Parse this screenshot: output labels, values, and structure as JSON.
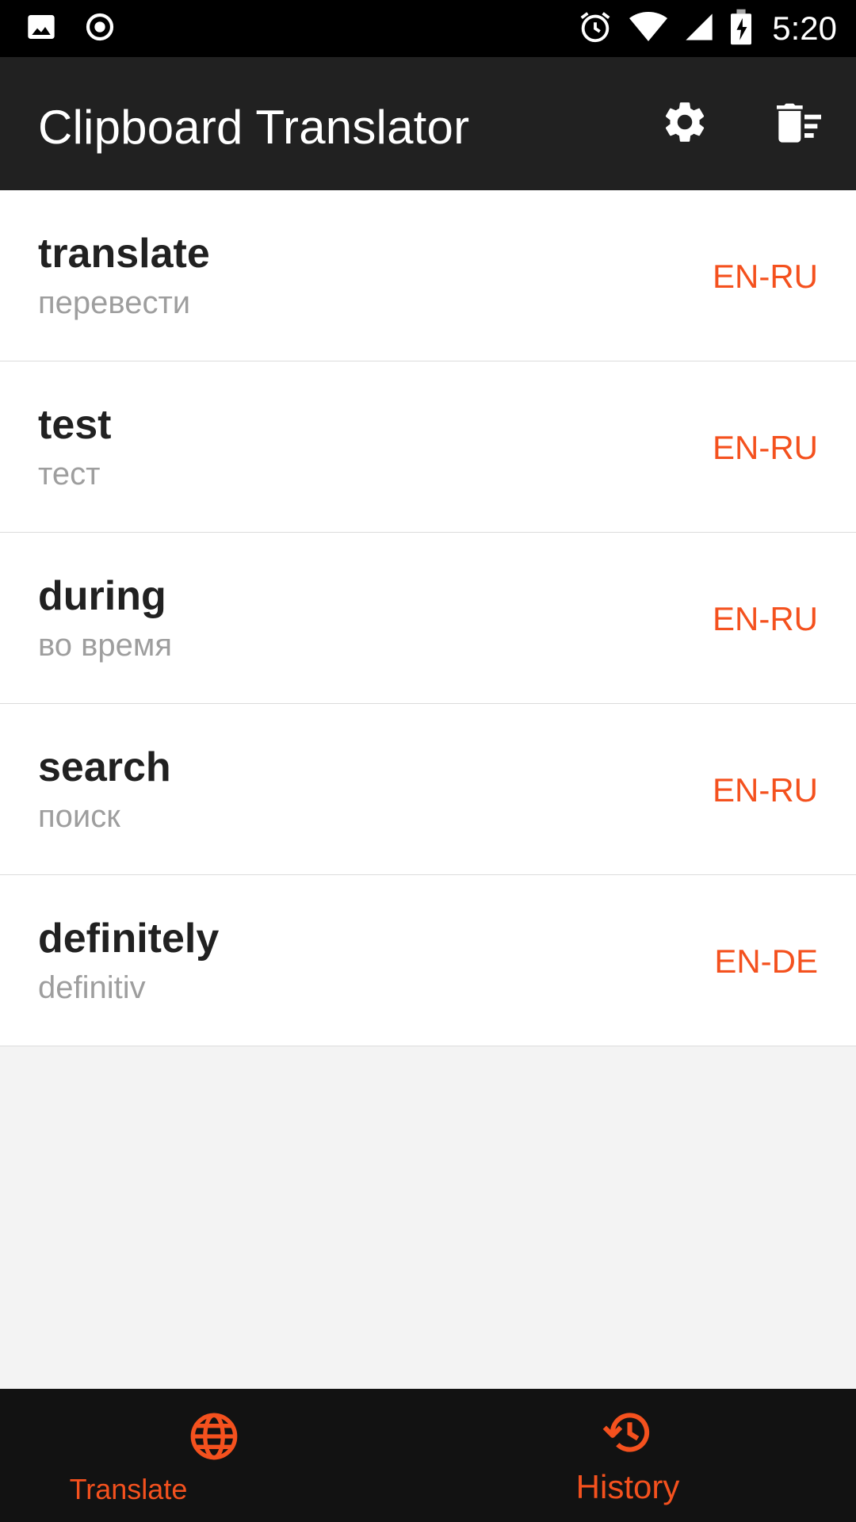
{
  "status_bar": {
    "time": "5:20",
    "icons": [
      "image-icon",
      "record-icon",
      "alarm-icon",
      "wifi-icon",
      "signal-icon",
      "battery-charging-icon"
    ]
  },
  "app_bar": {
    "title": "Clipboard Translator",
    "actions": [
      "gear-icon",
      "clear-history-icon"
    ]
  },
  "history": [
    {
      "word": "translate",
      "translation": "перевести",
      "lang": "EN-RU"
    },
    {
      "word": "test",
      "translation": "тест",
      "lang": "EN-RU"
    },
    {
      "word": "during",
      "translation": "во время",
      "lang": "EN-RU"
    },
    {
      "word": "search",
      "translation": "поиск",
      "lang": "EN-RU"
    },
    {
      "word": "definitely",
      "translation": "definitiv",
      "lang": "EN-DE"
    }
  ],
  "bottom_nav": {
    "translate_label": "Translate",
    "history_label": "History"
  },
  "colors": {
    "accent": "#f4511e",
    "app_bar": "#212121",
    "status_bar": "#000000",
    "bottom_nav": "#121212",
    "background": "#f3f3f3"
  }
}
